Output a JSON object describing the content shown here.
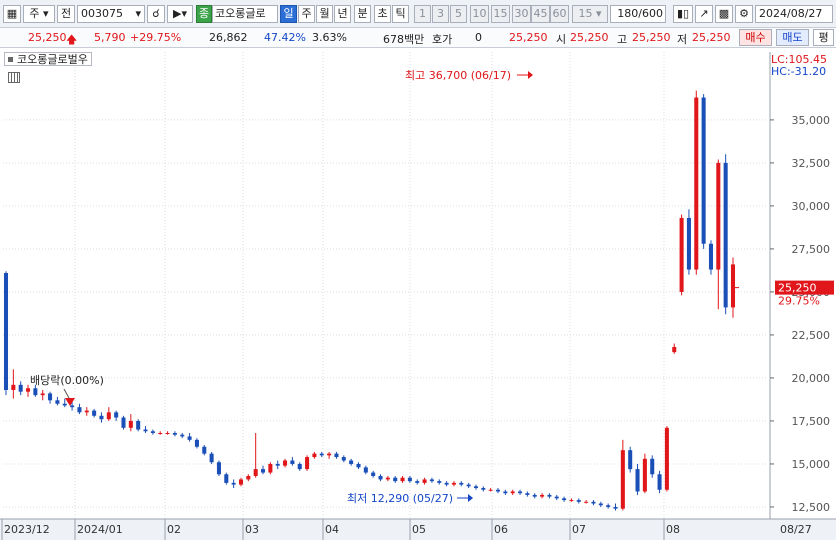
{
  "toolbar": {
    "mode1": "주",
    "mode2": "전",
    "code": "003075",
    "chg_icon": "종",
    "name": "코오롱글로",
    "periods": [
      "일",
      "주",
      "월",
      "년",
      "분",
      "초",
      "틱"
    ],
    "active_period": "일",
    "intervals": [
      "1",
      "3",
      "5",
      "10",
      "15",
      "30",
      "45",
      "60"
    ],
    "interval_value": "15",
    "count": "180",
    "count_total": "/600",
    "date": "2024/08/27"
  },
  "quote": {
    "price": "25,250",
    "change": "5,790",
    "change_pct": "+29.75%",
    "volume": "26,862",
    "ratio": "47.42%",
    "rate": "3.63%",
    "amount": "678백만",
    "hoga_label": "호가",
    "hoga_value": "0",
    "hoga_price": "25,250",
    "open_label": "시",
    "open": "25,250",
    "high_label": "고",
    "high": "25,250",
    "low_label": "저",
    "low": "25,250",
    "buy": "매수",
    "sell": "매도",
    "avg": "평"
  },
  "legend": {
    "label": "코오롱글로벌우"
  },
  "chart_data": {
    "type": "candlestick",
    "title": "코오롱글로벌우",
    "ylim": [
      11800,
      37900
    ],
    "y_ticks": [
      "12,500",
      "15,000",
      "17,500",
      "20,000",
      "22,500",
      "25,000",
      "27,500",
      "30,000",
      "32,500",
      "35,000"
    ],
    "x_ticks": [
      "2023/12",
      "2024/01",
      "02",
      "03",
      "04",
      "05",
      "06",
      "07",
      "08"
    ],
    "x_end_label": "08/27",
    "lc_label": "LC:105.45",
    "hc_label": "HC:-31.20",
    "last_price_label": "25,250",
    "last_change_label": "29.75%",
    "high_annotation": "최고 36,700 (06/17)",
    "low_annotation": "최저 12,290 (05/27)",
    "dividend_annotation": "배당락(0.00%)",
    "colors": {
      "up": "#e0161a",
      "down": "#1a4fb8",
      "grid": "#d9dde4"
    },
    "candles": [
      [
        26100,
        26200,
        19000,
        19300
      ],
      [
        19300,
        20500,
        18800,
        19600
      ],
      [
        19600,
        19800,
        19000,
        19200
      ],
      [
        19200,
        19600,
        18900,
        19400
      ],
      [
        19400,
        19600,
        18900,
        19000
      ],
      [
        19000,
        19300,
        18700,
        19100
      ],
      [
        19100,
        19200,
        18500,
        18700
      ],
      [
        18700,
        18900,
        18400,
        18500
      ],
      [
        18500,
        18800,
        18300,
        18400
      ],
      [
        18400,
        18600,
        18100,
        18300
      ],
      [
        18300,
        18500,
        17900,
        18000
      ],
      [
        18000,
        18300,
        17800,
        18100
      ],
      [
        18100,
        18200,
        17700,
        17800
      ],
      [
        17800,
        18000,
        17400,
        17600
      ],
      [
        17600,
        18300,
        17500,
        18000
      ],
      [
        18000,
        18100,
        17500,
        17700
      ],
      [
        17700,
        17800,
        17000,
        17100
      ],
      [
        17100,
        17900,
        16900,
        17500
      ],
      [
        17500,
        17600,
        16900,
        17000
      ],
      [
        17000,
        17200,
        16800,
        16900
      ],
      [
        16900,
        17000,
        16700,
        16800
      ],
      [
        16800,
        16900,
        16700,
        16800
      ],
      [
        16800,
        16900,
        16700,
        16800
      ],
      [
        16800,
        16900,
        16600,
        16700
      ],
      [
        16700,
        16800,
        16500,
        16600
      ],
      [
        16600,
        16800,
        16300,
        16400
      ],
      [
        16400,
        16500,
        15900,
        16000
      ],
      [
        16000,
        16100,
        15500,
        15600
      ],
      [
        15600,
        15700,
        15000,
        15100
      ],
      [
        15100,
        15200,
        14300,
        14400
      ],
      [
        14400,
        14500,
        13800,
        13900
      ],
      [
        13900,
        14100,
        13600,
        13800
      ],
      [
        13800,
        14200,
        13700,
        14100
      ],
      [
        14100,
        14400,
        14000,
        14300
      ],
      [
        14300,
        16800,
        14200,
        14700
      ],
      [
        14700,
        14900,
        14400,
        14500
      ],
      [
        14500,
        15100,
        14400,
        15000
      ],
      [
        15000,
        15200,
        14700,
        14900
      ],
      [
        14900,
        15300,
        14800,
        15200
      ],
      [
        15200,
        15400,
        14900,
        15000
      ],
      [
        15000,
        15100,
        14600,
        14700
      ],
      [
        14700,
        15500,
        14600,
        15400
      ],
      [
        15400,
        15700,
        15300,
        15600
      ],
      [
        15600,
        15700,
        15400,
        15500
      ],
      [
        15500,
        15700,
        15300,
        15600
      ],
      [
        15600,
        15700,
        15300,
        15400
      ],
      [
        15400,
        15500,
        15100,
        15200
      ],
      [
        15200,
        15300,
        14900,
        15000
      ],
      [
        15000,
        15100,
        14700,
        14800
      ],
      [
        14800,
        14900,
        14400,
        14500
      ],
      [
        14500,
        14600,
        14200,
        14300
      ],
      [
        14300,
        14400,
        14000,
        14100
      ],
      [
        14100,
        14300,
        14000,
        14200
      ],
      [
        14200,
        14300,
        13900,
        14000
      ],
      [
        14000,
        14300,
        13900,
        14200
      ],
      [
        14200,
        14300,
        13900,
        14000
      ],
      [
        14000,
        14100,
        13800,
        13900
      ],
      [
        13900,
        14200,
        13800,
        14100
      ],
      [
        14100,
        14200,
        13900,
        14000
      ],
      [
        14000,
        14100,
        13800,
        13900
      ],
      [
        13900,
        14000,
        13700,
        13800
      ],
      [
        13800,
        14000,
        13700,
        13900
      ],
      [
        13900,
        14000,
        13700,
        13800
      ],
      [
        13800,
        13900,
        13600,
        13700
      ],
      [
        13700,
        13800,
        13500,
        13600
      ],
      [
        13600,
        13700,
        13400,
        13500
      ],
      [
        13500,
        13600,
        13400,
        13500
      ],
      [
        13500,
        13600,
        13300,
        13400
      ],
      [
        13400,
        13500,
        13200,
        13300
      ],
      [
        13300,
        13500,
        13200,
        13400
      ],
      [
        13400,
        13500,
        13200,
        13300
      ],
      [
        13300,
        13400,
        13100,
        13200
      ],
      [
        13200,
        13300,
        13000,
        13100
      ],
      [
        13100,
        13300,
        13000,
        13200
      ],
      [
        13200,
        13300,
        13000,
        13100
      ],
      [
        13100,
        13200,
        12900,
        13000
      ],
      [
        13000,
        13100,
        12800,
        12900
      ],
      [
        12900,
        13000,
        12800,
        12900
      ],
      [
        12900,
        13000,
        12700,
        12800
      ],
      [
        12800,
        12900,
        12700,
        12800
      ],
      [
        12800,
        12900,
        12600,
        12700
      ],
      [
        12700,
        12800,
        12500,
        12600
      ],
      [
        12600,
        12700,
        12400,
        12500
      ],
      [
        12500,
        12700,
        12290,
        12400
      ],
      [
        12400,
        16400,
        12300,
        15800
      ],
      [
        15800,
        16000,
        14500,
        14700
      ],
      [
        14700,
        15000,
        13200,
        13400
      ],
      [
        13400,
        15600,
        13300,
        15300
      ],
      [
        15300,
        15500,
        14200,
        14400
      ],
      [
        14400,
        14600,
        13300,
        13500
      ],
      [
        13500,
        17200,
        13400,
        17100
      ],
      [
        21500,
        22000,
        21400,
        21800
      ],
      [
        25000,
        29500,
        24800,
        29300
      ],
      [
        29300,
        29800,
        26000,
        26300
      ],
      [
        26300,
        36700,
        26000,
        36300
      ],
      [
        36300,
        36500,
        27500,
        27800
      ],
      [
        27800,
        28000,
        26000,
        26300
      ],
      [
        26300,
        32700,
        24000,
        32500
      ],
      [
        32500,
        33000,
        23700,
        24100
      ],
      [
        24100,
        27000,
        23500,
        26600
      ]
    ]
  }
}
